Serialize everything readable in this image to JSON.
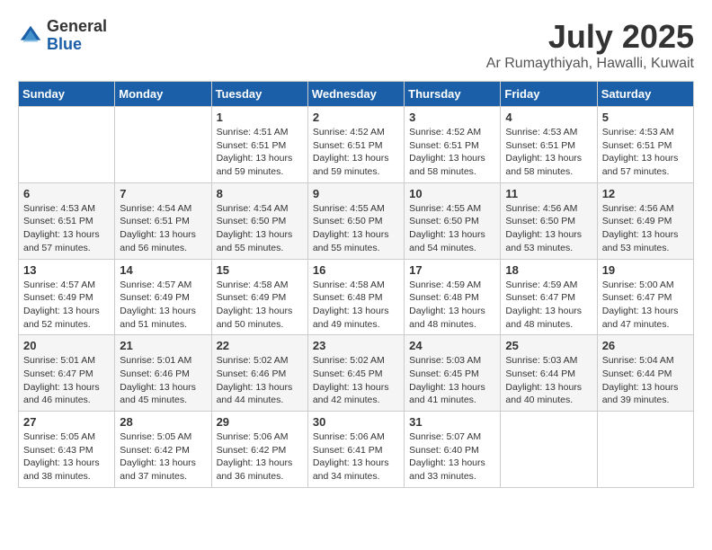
{
  "logo": {
    "general": "General",
    "blue": "Blue"
  },
  "title": {
    "month": "July 2025",
    "location": "Ar Rumaythiyah, Hawalli, Kuwait"
  },
  "days_of_week": [
    "Sunday",
    "Monday",
    "Tuesday",
    "Wednesday",
    "Thursday",
    "Friday",
    "Saturday"
  ],
  "weeks": [
    [
      {
        "day": "",
        "info": ""
      },
      {
        "day": "",
        "info": ""
      },
      {
        "day": "1",
        "info": "Sunrise: 4:51 AM\nSunset: 6:51 PM\nDaylight: 13 hours and 59 minutes."
      },
      {
        "day": "2",
        "info": "Sunrise: 4:52 AM\nSunset: 6:51 PM\nDaylight: 13 hours and 59 minutes."
      },
      {
        "day": "3",
        "info": "Sunrise: 4:52 AM\nSunset: 6:51 PM\nDaylight: 13 hours and 58 minutes."
      },
      {
        "day": "4",
        "info": "Sunrise: 4:53 AM\nSunset: 6:51 PM\nDaylight: 13 hours and 58 minutes."
      },
      {
        "day": "5",
        "info": "Sunrise: 4:53 AM\nSunset: 6:51 PM\nDaylight: 13 hours and 57 minutes."
      }
    ],
    [
      {
        "day": "6",
        "info": "Sunrise: 4:53 AM\nSunset: 6:51 PM\nDaylight: 13 hours and 57 minutes."
      },
      {
        "day": "7",
        "info": "Sunrise: 4:54 AM\nSunset: 6:51 PM\nDaylight: 13 hours and 56 minutes."
      },
      {
        "day": "8",
        "info": "Sunrise: 4:54 AM\nSunset: 6:50 PM\nDaylight: 13 hours and 55 minutes."
      },
      {
        "day": "9",
        "info": "Sunrise: 4:55 AM\nSunset: 6:50 PM\nDaylight: 13 hours and 55 minutes."
      },
      {
        "day": "10",
        "info": "Sunrise: 4:55 AM\nSunset: 6:50 PM\nDaylight: 13 hours and 54 minutes."
      },
      {
        "day": "11",
        "info": "Sunrise: 4:56 AM\nSunset: 6:50 PM\nDaylight: 13 hours and 53 minutes."
      },
      {
        "day": "12",
        "info": "Sunrise: 4:56 AM\nSunset: 6:49 PM\nDaylight: 13 hours and 53 minutes."
      }
    ],
    [
      {
        "day": "13",
        "info": "Sunrise: 4:57 AM\nSunset: 6:49 PM\nDaylight: 13 hours and 52 minutes."
      },
      {
        "day": "14",
        "info": "Sunrise: 4:57 AM\nSunset: 6:49 PM\nDaylight: 13 hours and 51 minutes."
      },
      {
        "day": "15",
        "info": "Sunrise: 4:58 AM\nSunset: 6:49 PM\nDaylight: 13 hours and 50 minutes."
      },
      {
        "day": "16",
        "info": "Sunrise: 4:58 AM\nSunset: 6:48 PM\nDaylight: 13 hours and 49 minutes."
      },
      {
        "day": "17",
        "info": "Sunrise: 4:59 AM\nSunset: 6:48 PM\nDaylight: 13 hours and 48 minutes."
      },
      {
        "day": "18",
        "info": "Sunrise: 4:59 AM\nSunset: 6:47 PM\nDaylight: 13 hours and 48 minutes."
      },
      {
        "day": "19",
        "info": "Sunrise: 5:00 AM\nSunset: 6:47 PM\nDaylight: 13 hours and 47 minutes."
      }
    ],
    [
      {
        "day": "20",
        "info": "Sunrise: 5:01 AM\nSunset: 6:47 PM\nDaylight: 13 hours and 46 minutes."
      },
      {
        "day": "21",
        "info": "Sunrise: 5:01 AM\nSunset: 6:46 PM\nDaylight: 13 hours and 45 minutes."
      },
      {
        "day": "22",
        "info": "Sunrise: 5:02 AM\nSunset: 6:46 PM\nDaylight: 13 hours and 44 minutes."
      },
      {
        "day": "23",
        "info": "Sunrise: 5:02 AM\nSunset: 6:45 PM\nDaylight: 13 hours and 42 minutes."
      },
      {
        "day": "24",
        "info": "Sunrise: 5:03 AM\nSunset: 6:45 PM\nDaylight: 13 hours and 41 minutes."
      },
      {
        "day": "25",
        "info": "Sunrise: 5:03 AM\nSunset: 6:44 PM\nDaylight: 13 hours and 40 minutes."
      },
      {
        "day": "26",
        "info": "Sunrise: 5:04 AM\nSunset: 6:44 PM\nDaylight: 13 hours and 39 minutes."
      }
    ],
    [
      {
        "day": "27",
        "info": "Sunrise: 5:05 AM\nSunset: 6:43 PM\nDaylight: 13 hours and 38 minutes."
      },
      {
        "day": "28",
        "info": "Sunrise: 5:05 AM\nSunset: 6:42 PM\nDaylight: 13 hours and 37 minutes."
      },
      {
        "day": "29",
        "info": "Sunrise: 5:06 AM\nSunset: 6:42 PM\nDaylight: 13 hours and 36 minutes."
      },
      {
        "day": "30",
        "info": "Sunrise: 5:06 AM\nSunset: 6:41 PM\nDaylight: 13 hours and 34 minutes."
      },
      {
        "day": "31",
        "info": "Sunrise: 5:07 AM\nSunset: 6:40 PM\nDaylight: 13 hours and 33 minutes."
      },
      {
        "day": "",
        "info": ""
      },
      {
        "day": "",
        "info": ""
      }
    ]
  ]
}
